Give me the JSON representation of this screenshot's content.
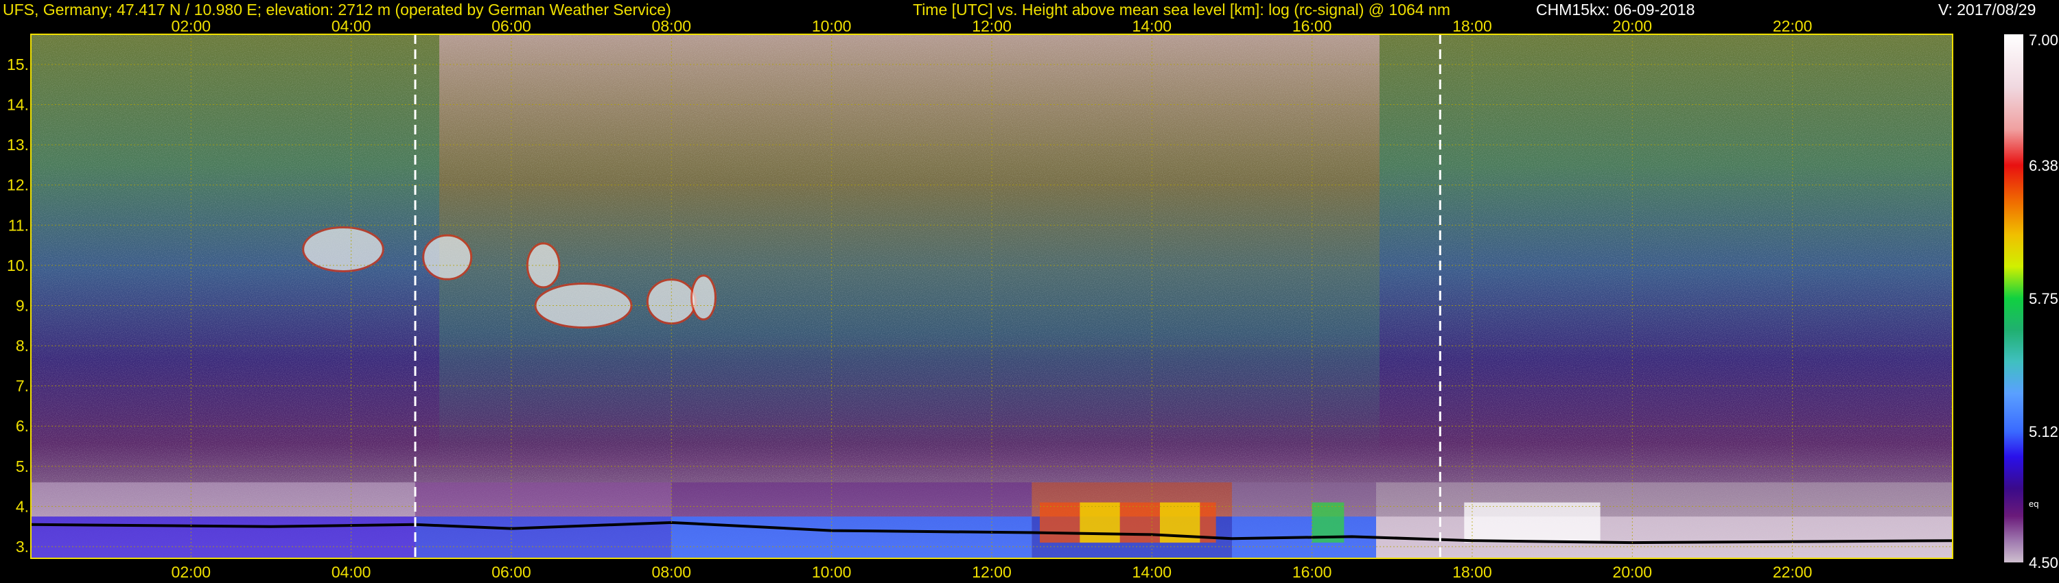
{
  "header": {
    "site": "UFS, Germany; 47.417 N / 10.980 E; elevation: 2712 m  (operated by German Weather Service)",
    "title": "Time [UTC] vs. Height above mean sea level [km]: log (rc-signal) @ 1064 nm",
    "instrument": "CHM15kx: 06-09-2018",
    "version": "V: 2017/08/29"
  },
  "colors": {
    "text": "#f0e000",
    "grid": "#b4a400",
    "background": "#000000",
    "marker_lines": "#ffffff"
  },
  "chart_data": {
    "type": "heatmap",
    "title": "Time [UTC] vs. Height above mean sea level [km]: log (rc-signal) @ 1064 nm",
    "x_unit": "hours UTC",
    "y_unit": "km",
    "xlim": [
      0,
      24
    ],
    "ylim": [
      2.71,
      15.75
    ],
    "x_ticks": [
      {
        "value": 2,
        "label": "02:00"
      },
      {
        "value": 4,
        "label": "04:00"
      },
      {
        "value": 6,
        "label": "06:00"
      },
      {
        "value": 8,
        "label": "08:00"
      },
      {
        "value": 10,
        "label": "10:00"
      },
      {
        "value": 12,
        "label": "12:00"
      },
      {
        "value": 14,
        "label": "14:00"
      },
      {
        "value": 16,
        "label": "16:00"
      },
      {
        "value": 18,
        "label": "18:00"
      },
      {
        "value": 20,
        "label": "20:00"
      },
      {
        "value": 22,
        "label": "22:00"
      }
    ],
    "y_ticks": [
      {
        "value": 3,
        "label": "3."
      },
      {
        "value": 4,
        "label": "4."
      },
      {
        "value": 5,
        "label": "5."
      },
      {
        "value": 6,
        "label": "6."
      },
      {
        "value": 7,
        "label": "7."
      },
      {
        "value": 8,
        "label": "8."
      },
      {
        "value": 9,
        "label": "9."
      },
      {
        "value": 10,
        "label": "10."
      },
      {
        "value": 11,
        "label": "11."
      },
      {
        "value": 12,
        "label": "12."
      },
      {
        "value": 13,
        "label": "13."
      },
      {
        "value": 14,
        "label": "14."
      },
      {
        "value": 15,
        "label": "15."
      }
    ],
    "grid": true,
    "sun_markers_utc": [
      4.8,
      17.6
    ],
    "colorbar": {
      "range": [
        4.5,
        7.0
      ],
      "labels": [
        {
          "value": 7.0,
          "label": "7.00"
        },
        {
          "value": 6.38,
          "label": "6.38"
        },
        {
          "value": 5.75,
          "label": "5.75"
        },
        {
          "value": 5.12,
          "label": "5.12"
        },
        {
          "value": 4.5,
          "label": "4.50"
        }
      ],
      "extra_label": {
        "value": 4.78,
        "label": "eq"
      },
      "stops": [
        {
          "v": 4.5,
          "c": "#cfc0cf"
        },
        {
          "v": 4.6,
          "c": "#a07ab0"
        },
        {
          "v": 4.72,
          "c": "#6a1a7a"
        },
        {
          "v": 4.85,
          "c": "#3a0a8a"
        },
        {
          "v": 5.0,
          "c": "#2a10ea"
        },
        {
          "v": 5.12,
          "c": "#3a6aff"
        },
        {
          "v": 5.3,
          "c": "#5aa0ff"
        },
        {
          "v": 5.45,
          "c": "#40c0c0"
        },
        {
          "v": 5.6,
          "c": "#20b070"
        },
        {
          "v": 5.75,
          "c": "#10d040"
        },
        {
          "v": 5.9,
          "c": "#d0f000"
        },
        {
          "v": 6.05,
          "c": "#f0c000"
        },
        {
          "v": 6.2,
          "c": "#f07000"
        },
        {
          "v": 6.38,
          "c": "#e81010"
        },
        {
          "v": 6.55,
          "c": "#f0a0a0"
        },
        {
          "v": 6.75,
          "c": "#f0d8e0"
        },
        {
          "v": 7.0,
          "c": "#ffffff"
        }
      ]
    }
  }
}
